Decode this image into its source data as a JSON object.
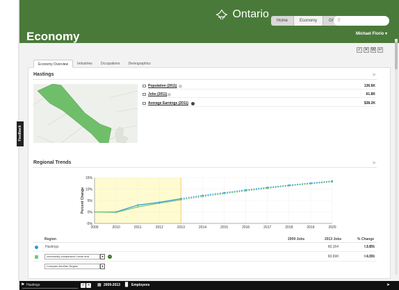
{
  "header": {
    "brand": "Ontario",
    "nav_tabs": [
      {
        "label": "Home",
        "active": false
      },
      {
        "label": "Economy",
        "active": true
      },
      {
        "label": "GIS",
        "active": false
      }
    ],
    "page_title": "Economy",
    "user_name": "Michael Florio ▾"
  },
  "tabs": [
    {
      "label": "Economy Overview",
      "active": true
    },
    {
      "label": "Industries",
      "active": false
    },
    {
      "label": "Occupations",
      "active": false
    },
    {
      "label": "Demographics",
      "active": false
    }
  ],
  "region": {
    "title": "Hastings",
    "stats": [
      {
        "label": "Population (2011)",
        "value": "136.6K"
      },
      {
        "label": "Jobs (2011)",
        "value": "61.8K"
      },
      {
        "label": "Average Earnings (2011)",
        "value": "$38.2K"
      }
    ]
  },
  "trends": {
    "title": "Regional Trends",
    "table": {
      "headers": {
        "region": "Region",
        "jobs_2009": "2009 Jobs",
        "jobs_2013": "2013 Jobs",
        "pct": "% Change"
      },
      "rows": [
        {
          "name": "Hastings",
          "jobs_2009": "60,164",
          "jobs_2013": "63,655",
          "pct": "5.8%",
          "color": "#2a9ad4"
        },
        {
          "name": "community comparison Leeds and",
          "jobs_2009": "60,690",
          "jobs_2013": "64,093",
          "pct": "5.3%",
          "color": "#7cc47f"
        }
      ],
      "compare_label": "Compare Another Region"
    }
  },
  "chart_data": {
    "type": "line",
    "ylabel": "Percent Change",
    "ylim": [
      -5,
      15
    ],
    "yticks": [
      "15%",
      "10%",
      "5%",
      "0%",
      "-5%"
    ],
    "x": [
      2009,
      2010,
      2011,
      2012,
      2013,
      2014,
      2015,
      2016,
      2017,
      2018,
      2019,
      2020
    ],
    "highlight_range": [
      2009,
      2013
    ],
    "series": [
      {
        "name": "Hastings",
        "color": "#2a9ad4",
        "values": [
          0,
          0,
          3.0,
          4.2,
          5.8,
          7.2,
          8.4,
          9.6,
          10.7,
          11.7,
          12.6,
          13.5
        ]
      },
      {
        "name": "community comparison Leeds and",
        "color": "#7cc47f",
        "values": [
          0,
          -0.2,
          2.2,
          3.8,
          5.3,
          6.7,
          8.0,
          9.2,
          10.3,
          11.4,
          12.3,
          13.1
        ]
      }
    ],
    "grid": true
  },
  "feedback_label": "Feedback",
  "footer": {
    "region": "Hastings",
    "period": "2009-2013",
    "metric": "Employees"
  },
  "colors": {
    "header_green": "#4a7a39",
    "map_fill": "#6fbf6a",
    "highlight": "#fffbd0"
  }
}
